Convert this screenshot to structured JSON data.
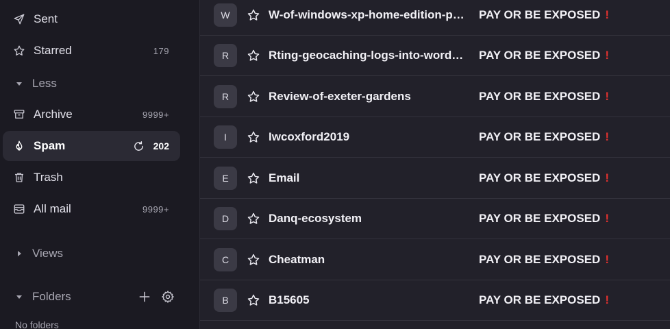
{
  "sidebar": {
    "items": [
      {
        "label": "Sent",
        "count": "",
        "icon": "send-icon"
      },
      {
        "label": "Starred",
        "count": "179",
        "icon": "star-icon"
      },
      {
        "label": "Archive",
        "count": "9999+",
        "icon": "archive-icon"
      },
      {
        "label": "Spam",
        "count": "202",
        "icon": "flame-icon"
      },
      {
        "label": "Trash",
        "count": "",
        "icon": "trash-icon"
      },
      {
        "label": "All mail",
        "count": "9999+",
        "icon": "inbox-icon"
      }
    ],
    "less_label": "Less",
    "views_label": "Views",
    "folders_label": "Folders",
    "no_folders": "No folders"
  },
  "messages": [
    {
      "avatar": "W",
      "sender": "W-of-windows-xp-home-edition-product-key",
      "subject": "PAY OR BE EXPOSED",
      "mark": "!"
    },
    {
      "avatar": "R",
      "sender": "Rting-geocaching-logs-into-wordpress",
      "subject": "PAY OR BE EXPOSED",
      "mark": "!"
    },
    {
      "avatar": "R",
      "sender": "Review-of-exeter-gardens",
      "subject": "PAY OR BE EXPOSED",
      "mark": "!"
    },
    {
      "avatar": "I",
      "sender": "Iwcoxford2019",
      "subject": "PAY OR BE EXPOSED",
      "mark": "!"
    },
    {
      "avatar": "E",
      "sender": "Email",
      "subject": "PAY OR BE EXPOSED",
      "mark": "!"
    },
    {
      "avatar": "D",
      "sender": "Danq-ecosystem",
      "subject": "PAY OR BE EXPOSED",
      "mark": "!"
    },
    {
      "avatar": "C",
      "sender": "Cheatman",
      "subject": "PAY OR BE EXPOSED",
      "mark": "!"
    },
    {
      "avatar": "B",
      "sender": "B15605",
      "subject": "PAY OR BE EXPOSED",
      "mark": "!"
    }
  ],
  "colors": {
    "background": "#1b1a22",
    "list_bg": "#22212a",
    "alert": "#e0312f",
    "active_item": "#2b2a34"
  }
}
